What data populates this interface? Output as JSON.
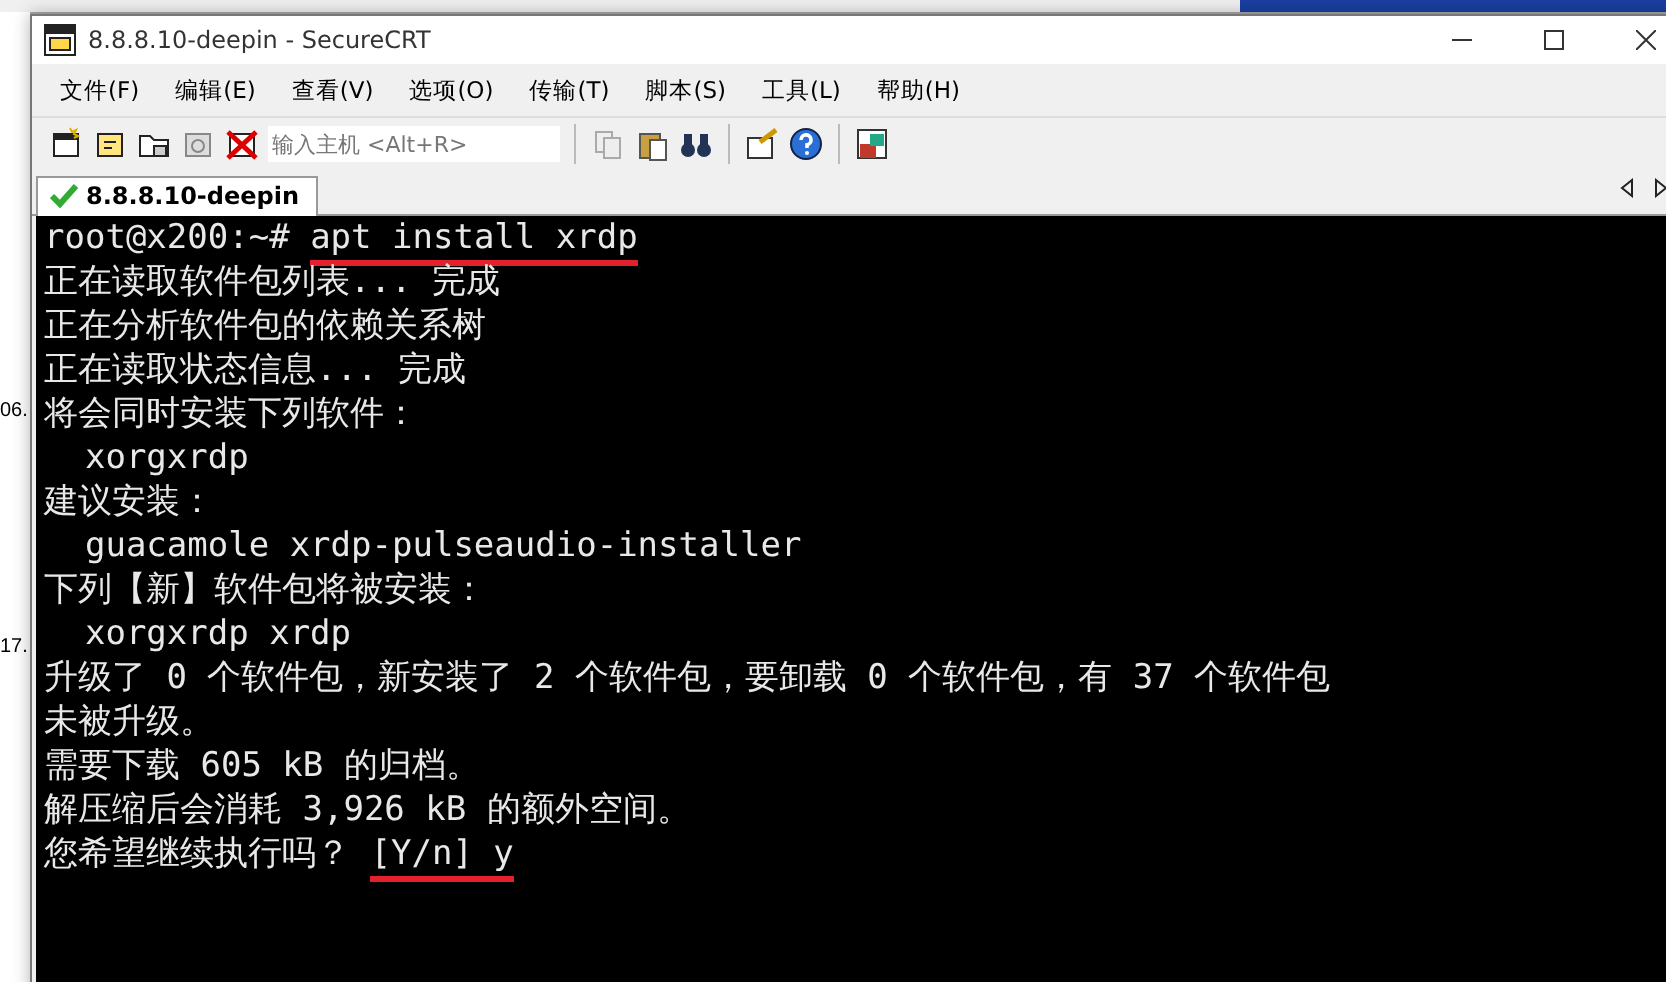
{
  "background": {
    "texts": [
      "06.",
      "17."
    ]
  },
  "window": {
    "title": "8.8.8.10-deepin - SecureCRT"
  },
  "menu": [
    "文件(F)",
    "编辑(E)",
    "查看(V)",
    "选项(O)",
    "传输(T)",
    "脚本(S)",
    "工具(L)",
    "帮助(H)"
  ],
  "toolbar": {
    "host_field": {
      "placeholder": "输入主机 <Alt+R>"
    }
  },
  "tabs": [
    {
      "label": "8.8.8.10-deepin",
      "selected": true,
      "connected": true
    }
  ],
  "terminal": {
    "lines": [
      {
        "segments": [
          {
            "text": "root@x200:~# ",
            "marked": false
          },
          {
            "text": "apt install xrdp",
            "marked": true
          }
        ]
      },
      {
        "segments": [
          {
            "text": "正在读取软件包列表... 完成",
            "marked": false
          }
        ]
      },
      {
        "segments": [
          {
            "text": "正在分析软件包的依赖关系树",
            "marked": false
          }
        ]
      },
      {
        "segments": [
          {
            "text": "正在读取状态信息... 完成",
            "marked": false
          }
        ]
      },
      {
        "segments": [
          {
            "text": "将会同时安装下列软件：",
            "marked": false
          }
        ]
      },
      {
        "segments": [
          {
            "text": "  xorgxrdp",
            "marked": false
          }
        ]
      },
      {
        "segments": [
          {
            "text": "建议安装：",
            "marked": false
          }
        ]
      },
      {
        "segments": [
          {
            "text": "  guacamole xrdp-pulseaudio-installer",
            "marked": false
          }
        ]
      },
      {
        "segments": [
          {
            "text": "下列【新】软件包将被安装：",
            "marked": false
          }
        ]
      },
      {
        "segments": [
          {
            "text": "  xorgxrdp xrdp",
            "marked": false
          }
        ]
      },
      {
        "segments": [
          {
            "text": "升级了 0 个软件包，新安装了 2 个软件包，要卸载 0 个软件包，有 37 个软件包",
            "marked": false
          }
        ]
      },
      {
        "segments": [
          {
            "text": "未被升级。",
            "marked": false
          }
        ]
      },
      {
        "segments": [
          {
            "text": "需要下载 605 kB 的归档。",
            "marked": false
          }
        ]
      },
      {
        "segments": [
          {
            "text": "解压缩后会消耗 3,926 kB 的额外空间。",
            "marked": false
          }
        ]
      },
      {
        "segments": [
          {
            "text": "您希望继续执行吗？ ",
            "marked": false
          },
          {
            "text": "[Y/n] y",
            "marked": true
          }
        ]
      }
    ]
  }
}
